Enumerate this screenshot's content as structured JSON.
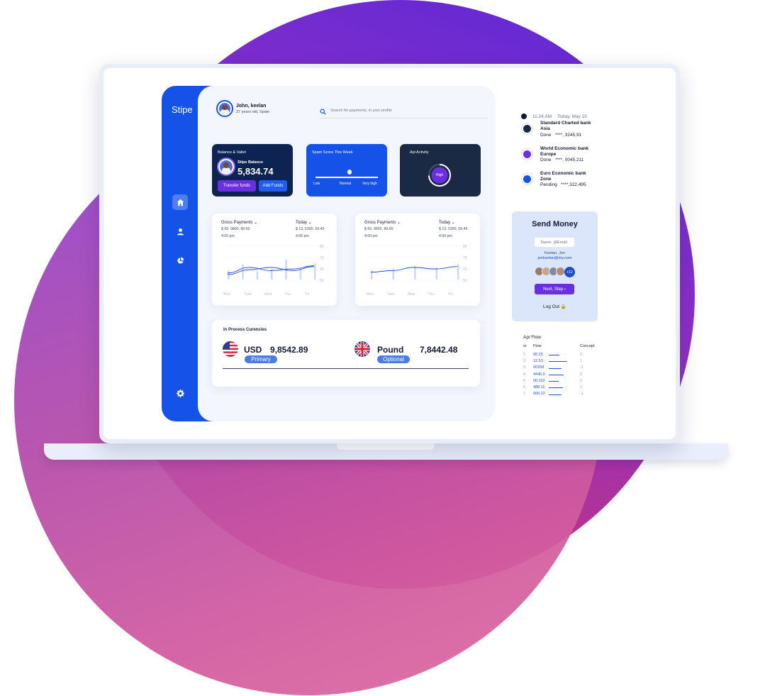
{
  "sidebar": {
    "brand": "Stipe",
    "items": [
      {
        "icon": "home-icon",
        "active": true
      },
      {
        "icon": "user-icon",
        "active": false
      },
      {
        "icon": "pie-chart-icon",
        "active": false
      },
      {
        "icon": "gear-icon",
        "active": false
      }
    ]
  },
  "header": {
    "user_name": "John, keelan",
    "user_sub": "27 years old, Spain",
    "search_placeholder": "Search for payments, in your profile"
  },
  "balance_card": {
    "title": "Balance & Vallet",
    "label": "Stipe Balance",
    "value": "5,834.74",
    "transfer_label": "Transfer funds",
    "add_label": "Add Funds"
  },
  "spam_card": {
    "title": "Spam Score This Week",
    "labels": [
      "Low",
      "Normal",
      "Very high"
    ]
  },
  "api_card": {
    "title": "Api Activity",
    "gauge_label": "High"
  },
  "charts": [
    {
      "title": "Gross Payments",
      "value": "$ 65, 9800, 89.65",
      "time": "4:00 pm",
      "title2": "Today",
      "value2": "$ 13, 5300, 59.45",
      "time2": "4:00 pm"
    },
    {
      "title": "Gross Payments",
      "value": "$ 65, 9800, 89.65",
      "time": "4:00 pm",
      "title2": "Today",
      "value2": "$ 13, 5300, 59.45",
      "time2": "4:00 pm"
    }
  ],
  "chart_data": [
    {
      "type": "line",
      "categories": [
        "Mon",
        "Tues",
        "Wed",
        "Thu",
        "Fri"
      ],
      "y_ticks": [
        "80",
        "70",
        "60",
        "50"
      ],
      "ylim": [
        45,
        85
      ],
      "series": [
        {
          "values": [
            55,
            62,
            58,
            60,
            64
          ]
        },
        {
          "values": [
            53,
            59,
            62,
            58,
            63
          ]
        }
      ],
      "bars": [
        58,
        66,
        57,
        60,
        72,
        61,
        67
      ]
    },
    {
      "type": "line",
      "categories": [
        "Mon",
        "Tues",
        "Wed",
        "Thu",
        "Fri"
      ],
      "y_ticks": [
        "80",
        "70",
        "60",
        "50"
      ],
      "ylim": [
        45,
        85
      ],
      "series": [
        {
          "values": [
            56,
            58,
            62,
            60,
            63
          ]
        }
      ],
      "bars": [
        58,
        60,
        64,
        62,
        66
      ]
    }
  ],
  "currencies": {
    "title": "In Process Curencies",
    "items": [
      {
        "code": "USD",
        "amount": "9,8542.89",
        "tag": "Primary"
      },
      {
        "code": "Pound",
        "amount": "7,8442.48",
        "tag": "Optional"
      }
    ]
  },
  "activity": {
    "time": "11:24 AM",
    "date": "Today, May 19",
    "transactions": [
      {
        "name": "Standard Charted bank Asia",
        "status": "Done",
        "amount": "****, 3245,91",
        "color": "#1a2a44"
      },
      {
        "name": "World Economic bank Europe",
        "status": "Done",
        "amount": "****, 0045,211",
        "color": "#6a2fe0"
      },
      {
        "name": "Euro Economic bank Zone",
        "status": "Pending",
        "amount": "****,322,495",
        "color": "#1552e8"
      }
    ]
  },
  "send_money": {
    "title": "Send Money",
    "input_placeholder": "Name, @Email.",
    "recipient_name": "Keelan, Jon",
    "recipient_email": "jonkeelan@my.com",
    "more_count": "+12",
    "next_label": "Next, Step",
    "logout_label": "Log Out"
  },
  "api_flow": {
    "title": "Api Flow",
    "headers": [
      "sr",
      "Flow",
      "Concept"
    ],
    "rows": [
      {
        "sr": "1",
        "flow": "00.25",
        "concept": "2",
        "bar": 0.5
      },
      {
        "sr": "2",
        "flow": "12.53",
        "concept": "1",
        "bar": 0.85
      },
      {
        "sr": "3",
        "flow": "00258",
        "concept": "-1",
        "bar": 0.6
      },
      {
        "sr": "4",
        "flow": "4445.0",
        "concept": "3",
        "bar": 0.7
      },
      {
        "sr": "5",
        "flow": "00.222",
        "concept": "2",
        "bar": 0.45
      },
      {
        "sr": "6",
        "flow": "488.11",
        "concept": "1",
        "bar": 0.65
      },
      {
        "sr": "7",
        "flow": "000.22",
        "concept": "-1",
        "bar": 0.6
      }
    ]
  }
}
